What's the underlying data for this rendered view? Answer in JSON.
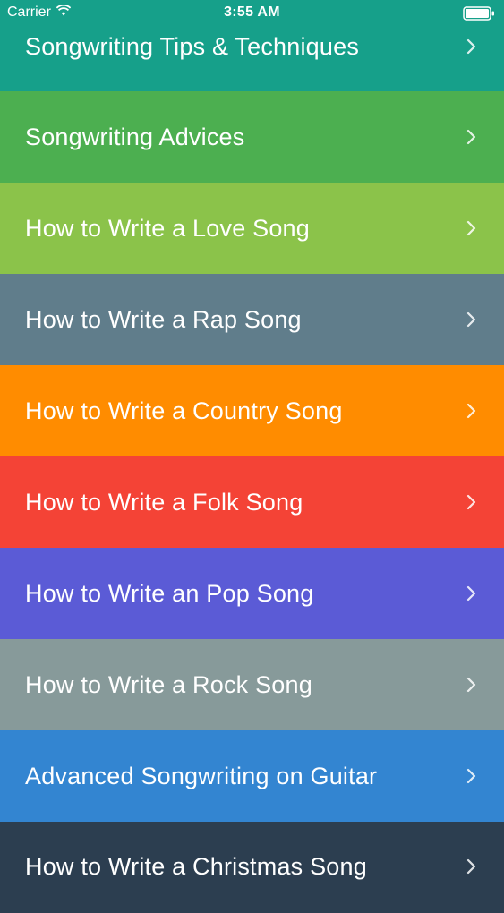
{
  "status_bar": {
    "carrier": "Carrier",
    "time": "3:55 AM",
    "wifi_icon": "wifi-icon",
    "battery_icon": "battery-icon"
  },
  "menu": {
    "items": [
      {
        "label": "Songwriting Tips & Techniques",
        "color": "#16a08a",
        "icon": "chevron-right-icon"
      },
      {
        "label": "Songwriting Advices",
        "color": "#4caf50",
        "icon": "chevron-right-icon"
      },
      {
        "label": "How to Write a Love Song",
        "color": "#8bc34a",
        "icon": "chevron-right-icon"
      },
      {
        "label": "How to Write a Rap Song",
        "color": "#607d8b",
        "icon": "chevron-right-icon"
      },
      {
        "label": "How to Write a Country Song",
        "color": "#ff8c00",
        "icon": "chevron-right-icon"
      },
      {
        "label": "How to Write a Folk Song",
        "color": "#f44336",
        "icon": "chevron-right-icon"
      },
      {
        "label": "How to Write an Pop Song",
        "color": "#5b5bd6",
        "icon": "chevron-right-icon"
      },
      {
        "label": "How to Write a Rock Song",
        "color": "#879a9a",
        "icon": "chevron-right-icon"
      },
      {
        "label": "Advanced Songwriting on Guitar",
        "color": "#3385d1",
        "icon": "chevron-right-icon"
      },
      {
        "label": "How to Write a Christmas Song",
        "color": "#2c3e50",
        "icon": "chevron-right-icon"
      }
    ]
  }
}
